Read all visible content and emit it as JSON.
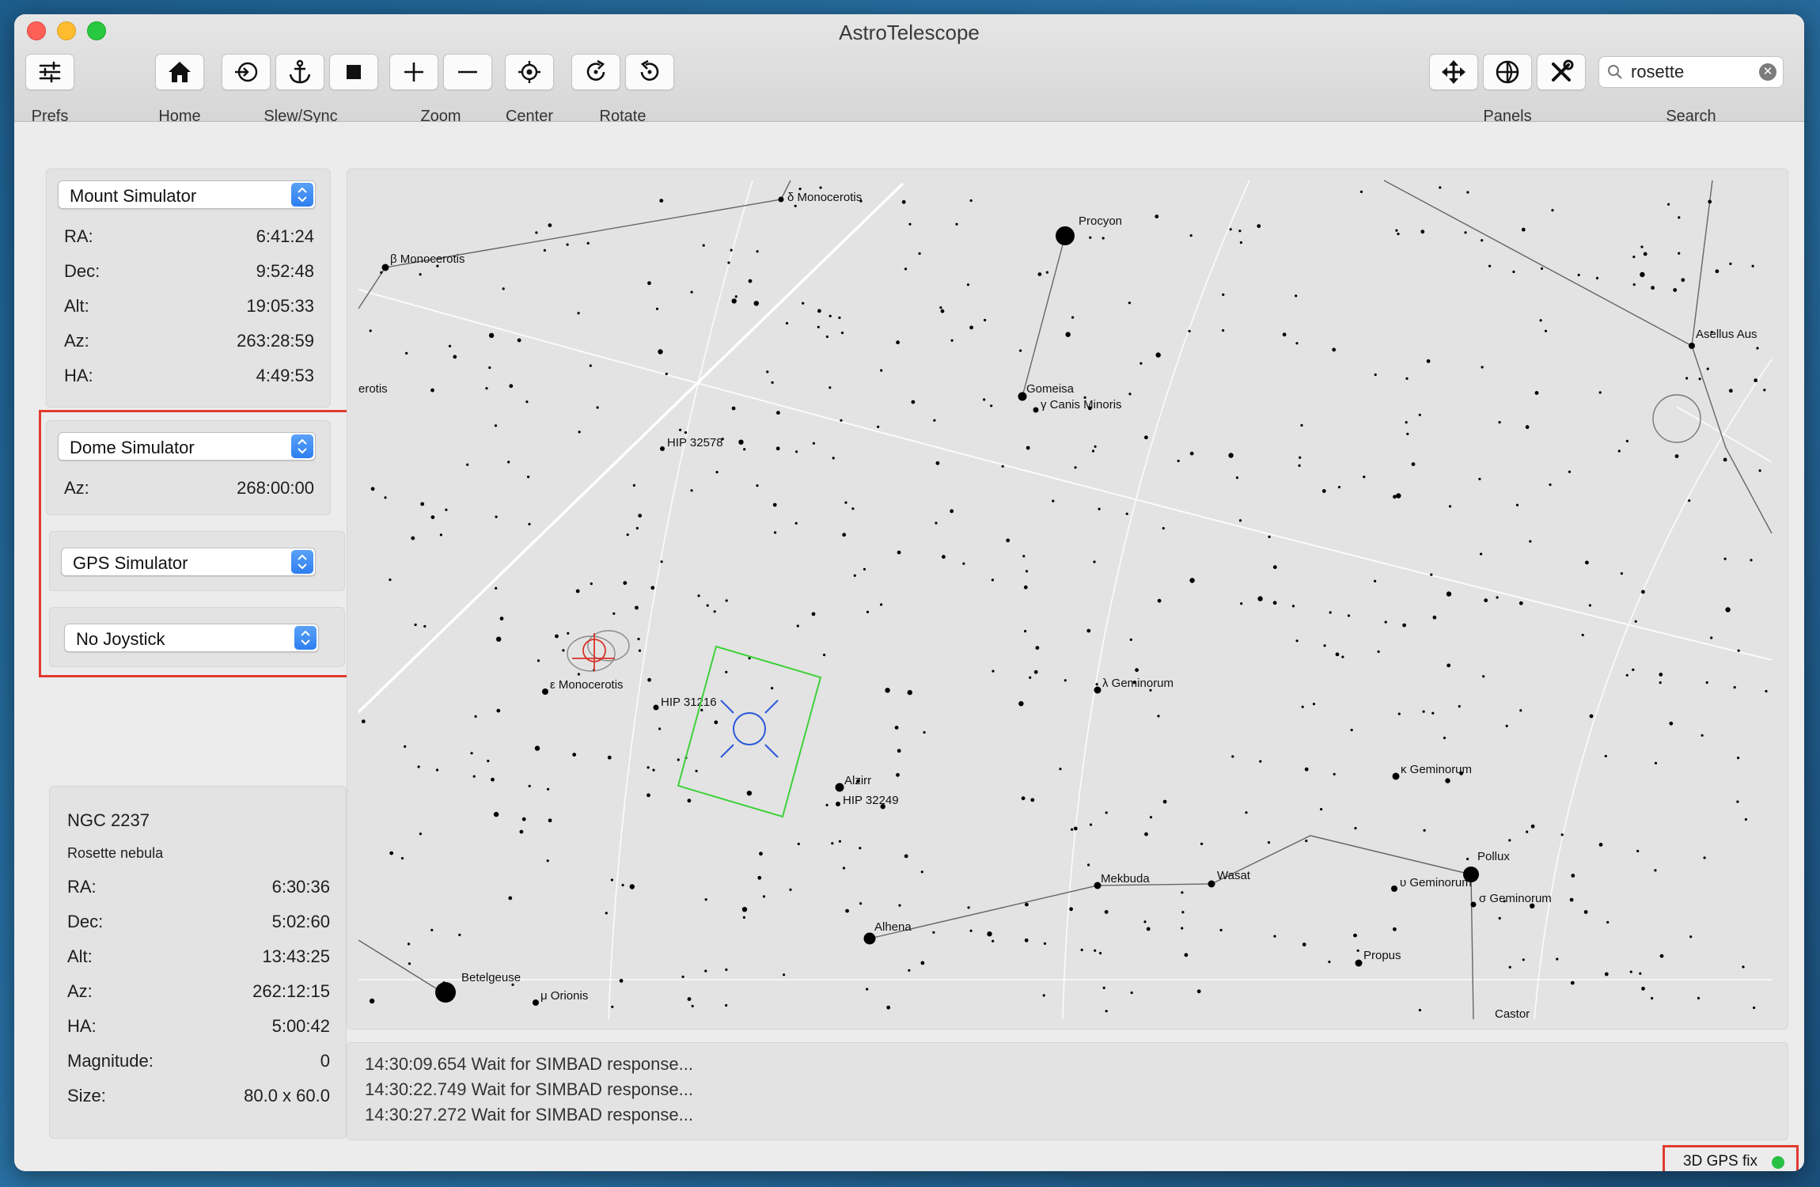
{
  "window": {
    "title": "AstroTelescope"
  },
  "toolbar": {
    "prefs_label": "Prefs",
    "home_label": "Home",
    "slew_label": "Slew/Sync",
    "zoom_label": "Zoom",
    "center_label": "Center",
    "rotate_label": "Rotate",
    "panels_label": "Panels",
    "search_label": "Search",
    "search_value": "rosette"
  },
  "mount": {
    "device": "Mount Simulator",
    "rows": [
      {
        "label": "RA:",
        "value": "6:41:24"
      },
      {
        "label": "Dec:",
        "value": "9:52:48"
      },
      {
        "label": "Alt:",
        "value": "19:05:33"
      },
      {
        "label": "Az:",
        "value": "263:28:59"
      },
      {
        "label": "HA:",
        "value": "4:49:53"
      }
    ]
  },
  "dome": {
    "device": "Dome Simulator",
    "az_label": "Az:",
    "az_value": "268:00:00"
  },
  "gps": {
    "device": "GPS Simulator"
  },
  "joystick": {
    "device": "No Joystick"
  },
  "target": {
    "name": "NGC 2237",
    "description": "Rosette nebula",
    "rows": [
      {
        "label": "RA:",
        "value": "6:30:36"
      },
      {
        "label": "Dec:",
        "value": "5:02:60"
      },
      {
        "label": "Alt:",
        "value": "13:43:25"
      },
      {
        "label": "Az:",
        "value": "262:12:15"
      },
      {
        "label": "HA:",
        "value": "5:00:42"
      },
      {
        "label": "Magnitude:",
        "value": "0"
      },
      {
        "label": "Size:",
        "value": "80.0 x 60.0"
      }
    ]
  },
  "log": [
    "14:30:09.654 Wait for SIMBAD response...",
    "14:30:22.749 Wait for SIMBAD response...",
    "14:30:27.272 Wait for SIMBAD response..."
  ],
  "status": {
    "gps_fix": "3D GPS fix",
    "fix_color": "#29c144"
  },
  "star_labels": {
    "procyon": "Procyon",
    "delta_mon": "δ Monocerotis",
    "beta_mon": "β Monocerotis",
    "mon_cut": "erotis",
    "gomeisa": "Gomeisa",
    "gamma_cmi": "γ Canis Minoris",
    "hip32578": "HIP 32578",
    "asellus": "Asellus Aus",
    "eps_mon": "ε Monocerotis",
    "hip31216": "HIP 31216",
    "lambda_gem": "λ Geminorum",
    "alzirr": "Alzirr",
    "hip32249": "HIP 32249",
    "kappa_gem": "κ Geminorum",
    "wasat": "Wasat",
    "pollux": "Pollux",
    "mekbuda": "Mekbuda",
    "upsilon_gem": "υ Geminorum",
    "sigma_gem": "σ Geminorum",
    "alhena": "Alhena",
    "propus": "Propus",
    "betelgeuse": "Betelgeuse",
    "mu_ori": "μ Orionis",
    "castor": "Castor"
  },
  "colors": {
    "fov_frame": "#3fd13a",
    "reticle": "#2b58d8",
    "mount_marker": "#d9322a",
    "accent": "#2e7ef0",
    "highlight": "#e23b2e"
  }
}
